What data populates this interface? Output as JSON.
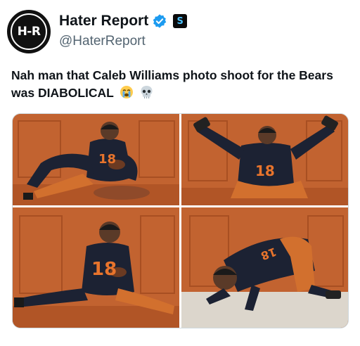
{
  "account": {
    "display_name": "Hater Report",
    "handle": "@HaterReport",
    "avatar_text": "H-R",
    "affiliate_badge": "S",
    "verified_color": "#1d9bf0"
  },
  "tweet": {
    "text": "Nah man that Caleb Williams photo shoot for the Bears was DIABOLICAL",
    "emojis": [
      "crying-face-icon",
      "skull-icon"
    ]
  },
  "media": {
    "photos": [
      {
        "jersey_number": "18",
        "description_icon": "photo"
      },
      {
        "jersey_number": "18",
        "description_icon": "photo"
      },
      {
        "jersey_number": "18",
        "description_icon": "photo"
      },
      {
        "jersey_number": "18",
        "description_icon": "photo"
      }
    ]
  },
  "colors": {
    "background_orange": "#c0602c",
    "jersey_navy": "#1c2233",
    "pants_orange": "#d2702e"
  }
}
